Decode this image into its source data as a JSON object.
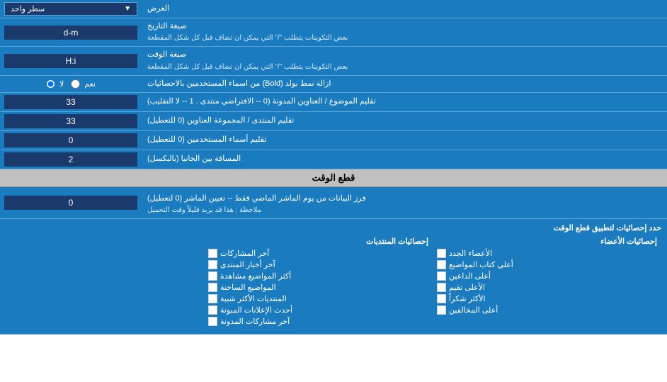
{
  "rows": [
    {
      "id": "display_row",
      "label": "العرض",
      "input_type": "dropdown",
      "input_value": "سطر واحد"
    },
    {
      "id": "date_format_row",
      "label": "صيغة التاريخ",
      "label_sub": "بعض التكوينات يتطلب \"/\" التي يمكن ان تضاف قبل كل شكل المقطعة",
      "input_type": "text",
      "input_value": "d-m"
    },
    {
      "id": "time_format_row",
      "label": "صيغة الوقت",
      "label_sub": "بعض التكوينات يتطلب \"/\" التي يمكن ان تضاف قبل كل شكل المقطعة",
      "input_type": "text",
      "input_value": "H:i"
    },
    {
      "id": "bold_row",
      "label": "ازالة نمط بولد (Bold) من اسماء المستخدمين بالاحصائيات",
      "input_type": "radio",
      "radio_yes": "نعم",
      "radio_no": "لا",
      "radio_selected": "no"
    },
    {
      "id": "topics_titles_row",
      "label": "تقليم الموضوع / العناوين المدونة (0 -- الافتراضي منتدى . 1 -- لا التقليب)",
      "input_type": "text",
      "input_value": "33"
    },
    {
      "id": "forum_titles_row",
      "label": "تقليم المنتدى / المجموعة العناوين (0 للتعطيل)",
      "input_type": "text",
      "input_value": "33"
    },
    {
      "id": "usernames_row",
      "label": "تقليم أسماء المستخدمين (0 للتعطيل)",
      "input_type": "text",
      "input_value": "0"
    },
    {
      "id": "spacing_row",
      "label": "المسافة بين الخانيا (بالبكسل)",
      "input_type": "text",
      "input_value": "2"
    }
  ],
  "section_header": "قطع الوقت",
  "cutoff_row": {
    "label": "فرز البيانات من يوم الماشر الماضي فقط -- تعيين الماشر (0 لتعطيل)",
    "label_sub": "ملاحظة : هذا قد يزيد قليلاً وقت التحميل",
    "input_value": "0"
  },
  "stats_section": {
    "title": "حدد إحصائيات لتطبيق قطع الوقت",
    "col1": {
      "title": "إحصائيات الأعضاء",
      "items": [
        "الأعضاء الجدد",
        "أعلى كتاب المواضيع",
        "أعلى الداعين",
        "الأعلى تقيم",
        "الأكثر شكراً",
        "أعلى المخالفين"
      ]
    },
    "col2": {
      "title": "إحصائيات المنتديات",
      "items": [
        "آخر المشاركات",
        "آخر أخبار المنتدى",
        "أكثر المواضيع مشاهدة",
        "المواضيع الساخنة",
        "المنتديات الأكثر شبية",
        "أحدث الإعلانات المبونة",
        "آخر مشاركات المدونة"
      ]
    }
  },
  "labels": {
    "display": "العرض",
    "date_format": "صيغة التاريخ",
    "time_format": "صيغة الوقت",
    "bold_remove": "ازالة نمط بولد (Bold) من اسماء المستخدمين بالاحصائيات",
    "topics_trim": "تقليم الموضوع / العناوين المدونة (0 -- الافتراضي منتدى . 1 -- لا التقليب)",
    "forum_trim": "تقليم المنتدى / المجموعة العناوين (0 للتعطيل)",
    "users_trim": "تقليم أسماء المستخدمين (0 للتعطيل)",
    "spacing": "المسافة بين الخانيا (بالبكسل)",
    "cutoff": "فرز البيانات من يوم الماشر الماضي فقط -- تعيين الماشر (0 لتعطيل)",
    "cutoff_note": "ملاحظة : هذا قد يزيد قليلاً وقت التحميل",
    "date_sub": "بعض التكوينات يتطلب \"/\" التي يمكن ان تضاف قبل كل شكل المقطعة",
    "time_sub": "بعض التكوينات يتطلب \"/\" التي يمكن ان تضاف قبل كل شكل المقطعة",
    "yes": "نعم",
    "no": "لا",
    "section_cutoff": "قطع الوقت",
    "single_line": "سطر واحد",
    "stats_apply": "حدد إحصائيات لتطبيق قطع الوقت",
    "col1_title": "إحصائيات الأعضاء",
    "col2_title": "إحصائيات المنتديات",
    "members_new": "الأعضاء الجدد",
    "top_writers": "أعلى كتاب المواضيع",
    "top_inviters": "أعلى الداعين",
    "top_rated": "الأعلى تقيم",
    "most_thanks": "الأكثر شكراً",
    "top_violators": "أعلى المخالفين",
    "last_posts": "آخر المشاركات",
    "last_news": "آخر أخبار المنتدى",
    "most_viewed": "أكثر المواضيع مشاهدة",
    "hot_topics": "المواضيع الساخنة",
    "most_similar": "المنتديات الأكثر شبية",
    "latest_ads": "أحدث الإعلانات المبونة",
    "last_blog_posts": "آخر مشاركات المدونة"
  }
}
